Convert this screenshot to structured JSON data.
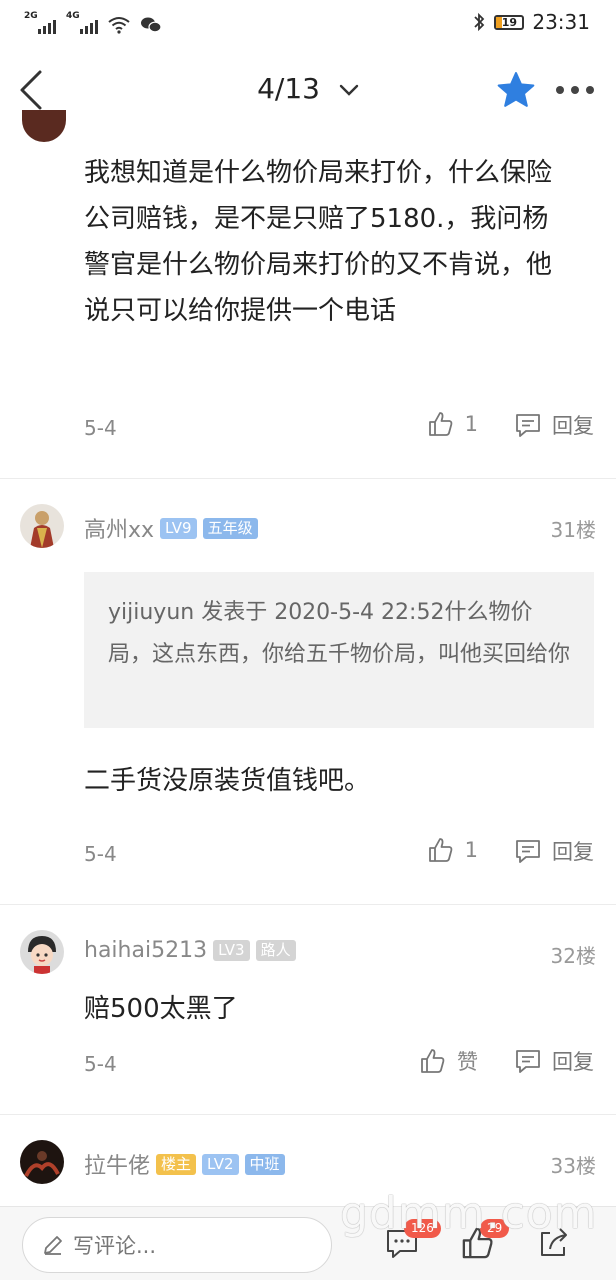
{
  "status_bar": {
    "sim1": "2G",
    "sim2": "4G",
    "battery": "19",
    "time": "23:31"
  },
  "nav": {
    "page_indicator": "4/13"
  },
  "posts": [
    {
      "text": "我想知道是什么物价局来打价，什么保险公司赔钱，是不是只赔了5180.，我问杨警官是什么物价局来打价的又不肯说，他说只可以给你提供一个电话",
      "date": "5-4",
      "likes": "1",
      "reply_label": "回复"
    },
    {
      "username": "高州xx",
      "level": "LV9",
      "grade": "五年级",
      "floor": "31楼",
      "quote": "yijiuyun 发表于 2020-5-4 22:52什么物价局，这点东西，你给五千物价局，叫他买回给你",
      "text": "二手货没原装货值钱吧。",
      "date": "5-4",
      "likes": "1",
      "reply_label": "回复"
    },
    {
      "username": "haihai5213",
      "level": "LV3",
      "grade": "路人",
      "floor": "32楼",
      "text": "赔500太黑了",
      "date": "5-4",
      "likes": "赞",
      "reply_label": "回复"
    },
    {
      "username": "拉牛佬",
      "owner_tag": "楼主",
      "level": "LV2",
      "grade": "中班",
      "floor": "33楼"
    }
  ],
  "bottom_bar": {
    "comment_placeholder": "写评论...",
    "comment_count": "126",
    "like_count": "29"
  },
  "watermark": "gdmm.com",
  "colors": {
    "accent_blue": "#2f7fe0",
    "badge_red": "#f15a4a",
    "owner_gold": "#f3c14c"
  }
}
